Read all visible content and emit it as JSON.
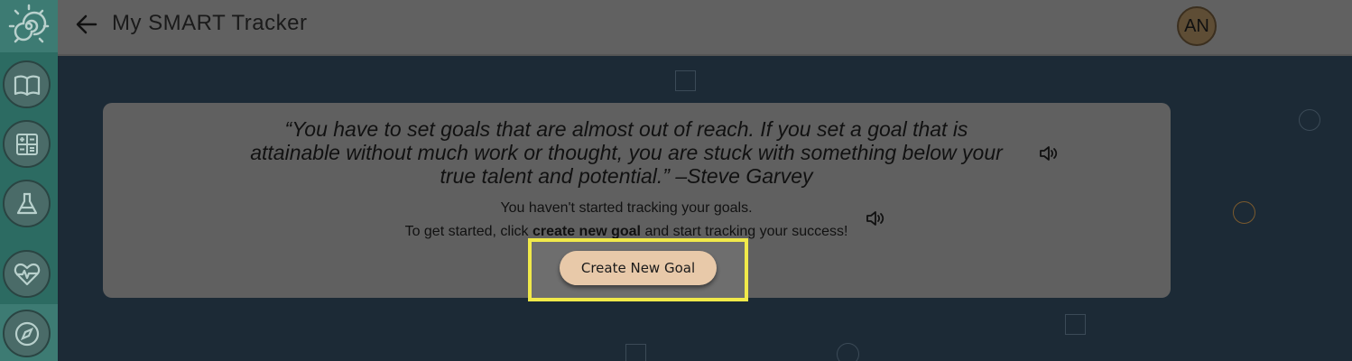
{
  "header": {
    "title": "My SMART Tracker",
    "avatar_initials": "AN"
  },
  "sidebar": {
    "items": [
      {
        "icon": "book-icon"
      },
      {
        "icon": "calculator-icon"
      },
      {
        "icon": "flask-icon"
      },
      {
        "icon": "heart-pulse-icon"
      },
      {
        "icon": "compass-icon"
      }
    ]
  },
  "card": {
    "quote": "“You have to set goals that are almost out of reach. If you set a goal that is attainable without much work or thought, you are stuck with something below your true talent and potential.” –Steve Garvey",
    "info_line1": "You haven't started tracking your goals.",
    "info_line2_pre": "To get started, click ",
    "info_line2_bold": "create new goal",
    "info_line2_post": " and start tracking your success!",
    "button_label": "Create New Goal"
  },
  "colors": {
    "sidebar": "#2c6b62",
    "header": "#616161",
    "background": "#1c2a36",
    "card": "#606060",
    "button": "#e8c9a9",
    "highlight": "#f0e94a"
  }
}
